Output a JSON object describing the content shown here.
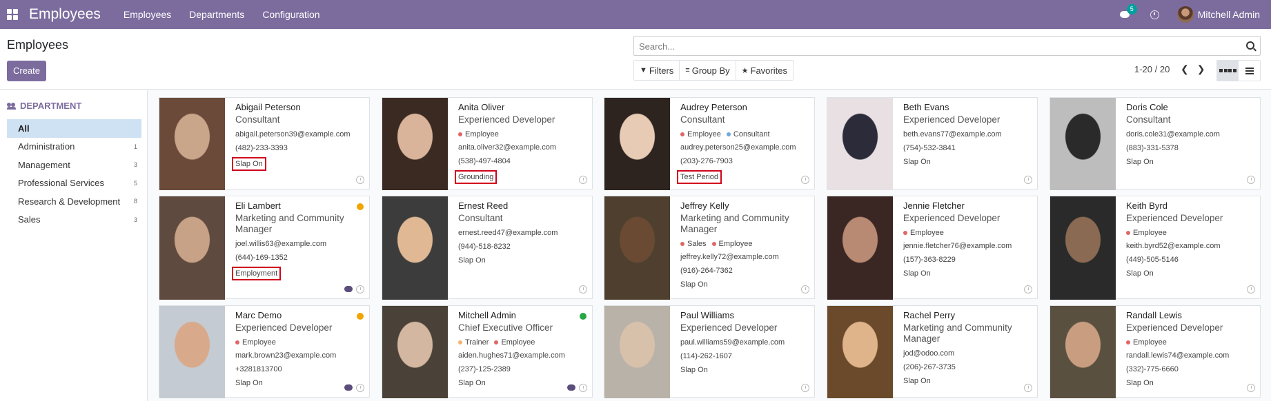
{
  "topbar": {
    "brand": "Employees",
    "menu": [
      "Employees",
      "Departments",
      "Configuration"
    ],
    "chat_badge": "5",
    "user_name": "Mitchell Admin"
  },
  "control_panel": {
    "title": "Employees",
    "create_label": "Create",
    "search_placeholder": "Search...",
    "filters_label": "Filters",
    "group_by_label": "Group By",
    "favorites_label": "Favorites",
    "pager": "1-20 / 20"
  },
  "sidebar": {
    "heading": "DEPARTMENT",
    "items": [
      {
        "label": "All",
        "count": ""
      },
      {
        "label": "Administration",
        "count": "1"
      },
      {
        "label": "Management",
        "count": "3"
      },
      {
        "label": "Professional Services",
        "count": "5"
      },
      {
        "label": "Research & Development",
        "count": "8"
      },
      {
        "label": "Sales",
        "count": "3"
      }
    ]
  },
  "colors": {
    "brand": "#7c6c9e",
    "tag_employee": "#e06666",
    "tag_consultant": "#6fa8dc",
    "tag_trainer": "#f6b26b",
    "status_orange": "#f0a500",
    "status_green": "#28a745",
    "highlight": "#d0021b"
  },
  "employees": [
    {
      "name": "Abigail Peterson",
      "job": "Consultant",
      "tags": [],
      "email": "abigail.peterson39@example.com",
      "phone": "(482)-233-3393",
      "stage": "Slap On",
      "stage_highlighted": true
    },
    {
      "name": "Anita Oliver",
      "job": "Experienced Developer",
      "tags": [
        "Employee"
      ],
      "email": "anita.oliver32@example.com",
      "phone": "(538)-497-4804",
      "stage": "Grounding",
      "stage_highlighted": true
    },
    {
      "name": "Audrey Peterson",
      "job": "Consultant",
      "tags": [
        "Employee",
        "Consultant"
      ],
      "email": "audrey.peterson25@example.com",
      "phone": "(203)-276-7903",
      "stage": "Test Period",
      "stage_highlighted": true
    },
    {
      "name": "Beth Evans",
      "job": "Experienced Developer",
      "tags": [],
      "email": "beth.evans77@example.com",
      "phone": "(754)-532-3841",
      "stage": "Slap On",
      "stage_highlighted": false
    },
    {
      "name": "Doris Cole",
      "job": "Consultant",
      "tags": [],
      "email": "doris.cole31@example.com",
      "phone": "(883)-331-5378",
      "stage": "Slap On",
      "stage_highlighted": false
    },
    {
      "name": "Eli Lambert",
      "job": "Marketing and Community Manager",
      "tags": [],
      "email": "joel.willis63@example.com",
      "phone": "(644)-169-1352",
      "stage": "Employment",
      "stage_highlighted": true
    },
    {
      "name": "Ernest Reed",
      "job": "Consultant",
      "tags": [],
      "email": "ernest.reed47@example.com",
      "phone": "(944)-518-8232",
      "stage": "Slap On",
      "stage_highlighted": false
    },
    {
      "name": "Jeffrey Kelly",
      "job": "Marketing and Community Manager",
      "tags": [
        "Sales",
        "Employee"
      ],
      "email": "jeffrey.kelly72@example.com",
      "phone": "(916)-264-7362",
      "stage": "Slap On",
      "stage_highlighted": false
    },
    {
      "name": "Jennie Fletcher",
      "job": "Experienced Developer",
      "tags": [
        "Employee"
      ],
      "email": "jennie.fletcher76@example.com",
      "phone": "(157)-363-8229",
      "stage": "Slap On",
      "stage_highlighted": false
    },
    {
      "name": "Keith Byrd",
      "job": "Experienced Developer",
      "tags": [
        "Employee"
      ],
      "email": "keith.byrd52@example.com",
      "phone": "(449)-505-5146",
      "stage": "Slap On",
      "stage_highlighted": false
    },
    {
      "name": "Marc Demo",
      "job": "Experienced Developer",
      "tags": [
        "Employee"
      ],
      "email": "mark.brown23@example.com",
      "phone": "+3281813700",
      "stage": "Slap On",
      "stage_highlighted": false
    },
    {
      "name": "Mitchell Admin",
      "job": "Chief Executive Officer",
      "tags": [
        "Trainer",
        "Employee"
      ],
      "email": "aiden.hughes71@example.com",
      "phone": "(237)-125-2389",
      "stage": "Slap On",
      "stage_highlighted": false
    },
    {
      "name": "Paul Williams",
      "job": "Experienced Developer",
      "tags": [],
      "email": "paul.williams59@example.com",
      "phone": "(114)-262-1607",
      "stage": "Slap On",
      "stage_highlighted": false
    },
    {
      "name": "Rachel Perry",
      "job": "Marketing and Community Manager",
      "tags": [],
      "email": "jod@odoo.com",
      "phone": "(206)-267-3735",
      "stage": "Slap On",
      "stage_highlighted": false
    },
    {
      "name": "Randall Lewis",
      "job": "Experienced Developer",
      "tags": [
        "Employee"
      ],
      "email": "randall.lewis74@example.com",
      "phone": "(332)-775-6660",
      "stage": "Slap On",
      "stage_highlighted": false
    }
  ]
}
